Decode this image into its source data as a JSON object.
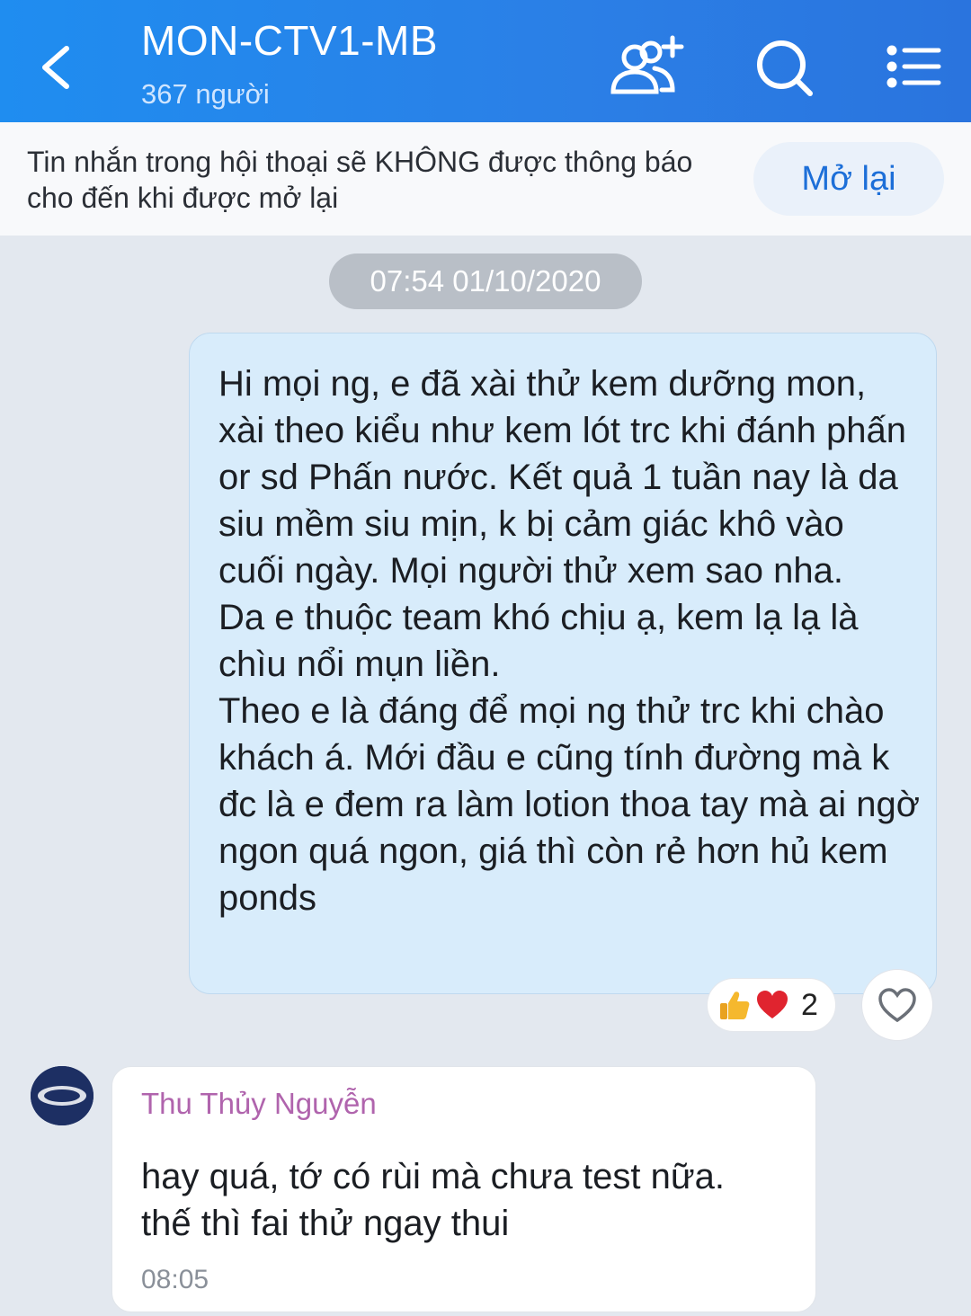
{
  "header": {
    "title": "MON-CTV1-MB",
    "subtitle": "367 người"
  },
  "mute_banner": {
    "text": "Tin nhắn trong hội thoại sẽ KHÔNG được thông báo cho đến khi được mở lại",
    "button_label": "Mở lại"
  },
  "timestamp": "07:54 01/10/2020",
  "outgoing": {
    "lines": [
      "Hi mọi ng, e đã xài thử kem dưỡng mon, xài theo kiểu như kem lót trc khi đánh phấn or sd Phấn nước. Kết quả 1 tuần nay là da siu mềm siu mịn, k bị cảm giác khô vào cuối ngày. Mọi người thử xem sao nha.",
      "Da e thuộc team khó chịu ạ, kem lạ lạ là chìu nổi mụn liền.",
      "Theo e là đáng để mọi ng thử trc khi chào khách á. Mới đầu e cũng tính đường mà k đc là e đem ra làm lotion thoa tay mà ai ngờ ngon quá ngon, giá thì còn rẻ hơn hủ kem ponds"
    ],
    "reactions": {
      "icons": [
        "thumbs-up",
        "heart"
      ],
      "count": "2"
    }
  },
  "incoming": {
    "sender": "Thu Thủy Nguyễn",
    "lines": [
      "hay quá, tớ có rùi mà chưa test nữa.",
      "thế thì fai thử ngay thui"
    ],
    "time": "08:05"
  }
}
